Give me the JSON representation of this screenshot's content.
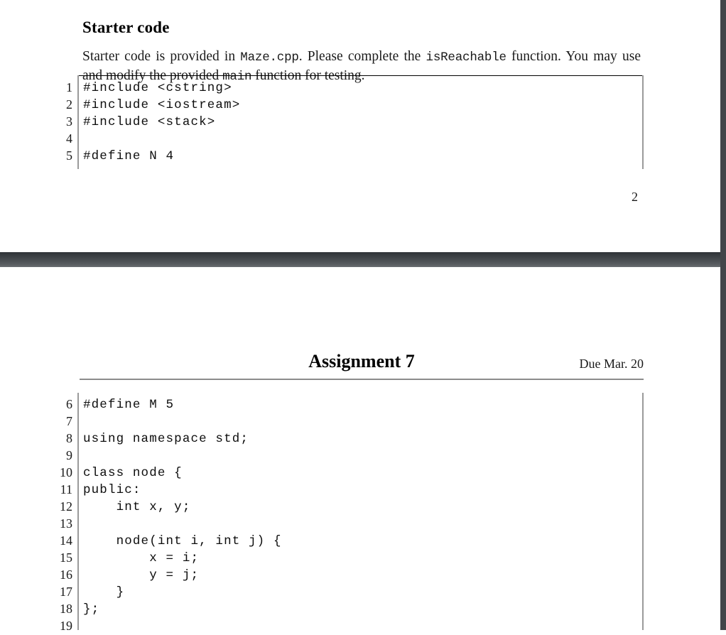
{
  "viewer": {
    "background_color": "#424549",
    "page_color": "#ffffff"
  },
  "page_1": {
    "section_heading": "Starter code",
    "paragraph": {
      "part_1": "Starter code is provided in ",
      "mono_1": "Maze.cpp",
      "part_2": ". Please complete the ",
      "mono_2": "isReachable",
      "part_3": " function. You may use and modify the provided ",
      "mono_3": "main",
      "part_4": " function for testing."
    },
    "folio": "2",
    "listing": {
      "lines": [
        {
          "n": "1",
          "code": "#include <cstring>"
        },
        {
          "n": "2",
          "code": "#include <iostream>"
        },
        {
          "n": "3",
          "code": "#include <stack>"
        },
        {
          "n": "4",
          "code": ""
        },
        {
          "n": "5",
          "code": "#define N 4"
        }
      ]
    }
  },
  "page_2": {
    "header": {
      "title": "Assignment 7",
      "due": "Due Mar. 20"
    },
    "listing": {
      "lines": [
        {
          "n": "6",
          "code": "#define M 5"
        },
        {
          "n": "7",
          "code": ""
        },
        {
          "n": "8",
          "code": "using namespace std;"
        },
        {
          "n": "9",
          "code": ""
        },
        {
          "n": "10",
          "code": "class node {"
        },
        {
          "n": "11",
          "code": "public:"
        },
        {
          "n": "12",
          "code": "    int x, y;"
        },
        {
          "n": "13",
          "code": ""
        },
        {
          "n": "14",
          "code": "    node(int i, int j) {"
        },
        {
          "n": "15",
          "code": "        x = i;"
        },
        {
          "n": "16",
          "code": "        y = j;"
        },
        {
          "n": "17",
          "code": "    }"
        },
        {
          "n": "18",
          "code": "};"
        },
        {
          "n": "19",
          "code": ""
        }
      ]
    }
  }
}
